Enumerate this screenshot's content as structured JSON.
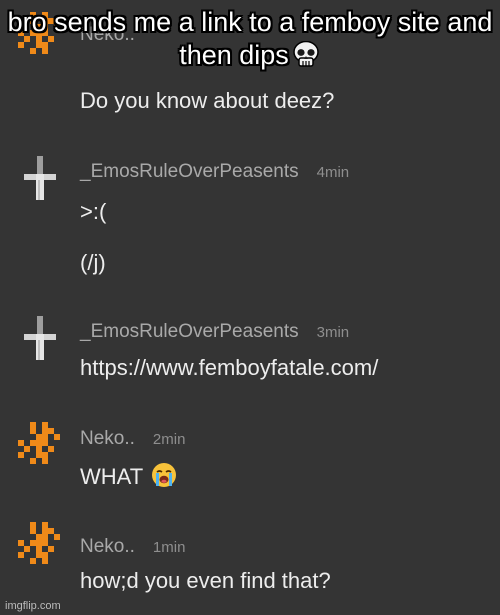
{
  "meme": {
    "caption": "bro sends me a link to a femboy site and then dips",
    "caption_emoji": "skull-emoji"
  },
  "colors": {
    "background": "#343434",
    "username": "#a9a9a9",
    "timestamp": "#8e8e8e",
    "message": "#ededed",
    "neko_avatar": "#f08a19",
    "emos_avatar": "#d4d4d4"
  },
  "messages": [
    {
      "username": "Neko..",
      "time": "",
      "avatar": "orange-pixel-cross-avatar",
      "lines": [
        "Do you know about deez?"
      ]
    },
    {
      "username": "_EmosRuleOverPeasents",
      "time": "4min",
      "avatar": "white-inverted-cross-avatar",
      "lines": [
        ">:(",
        "(/j)"
      ]
    },
    {
      "username": "_EmosRuleOverPeasents",
      "time": "3min",
      "avatar": "white-inverted-cross-avatar",
      "lines": [
        "https://www.femboyfatale.com/"
      ]
    },
    {
      "username": "Neko..",
      "time": "2min",
      "avatar": "orange-pixel-cross-avatar",
      "lines": [
        "WHAT"
      ],
      "emoji": "loudly-crying-emoji"
    },
    {
      "username": "Neko..",
      "time": "1min",
      "avatar": "orange-pixel-cross-avatar",
      "lines": [
        "how;d you even find that?"
      ]
    }
  ],
  "watermark": "imgflip.com"
}
